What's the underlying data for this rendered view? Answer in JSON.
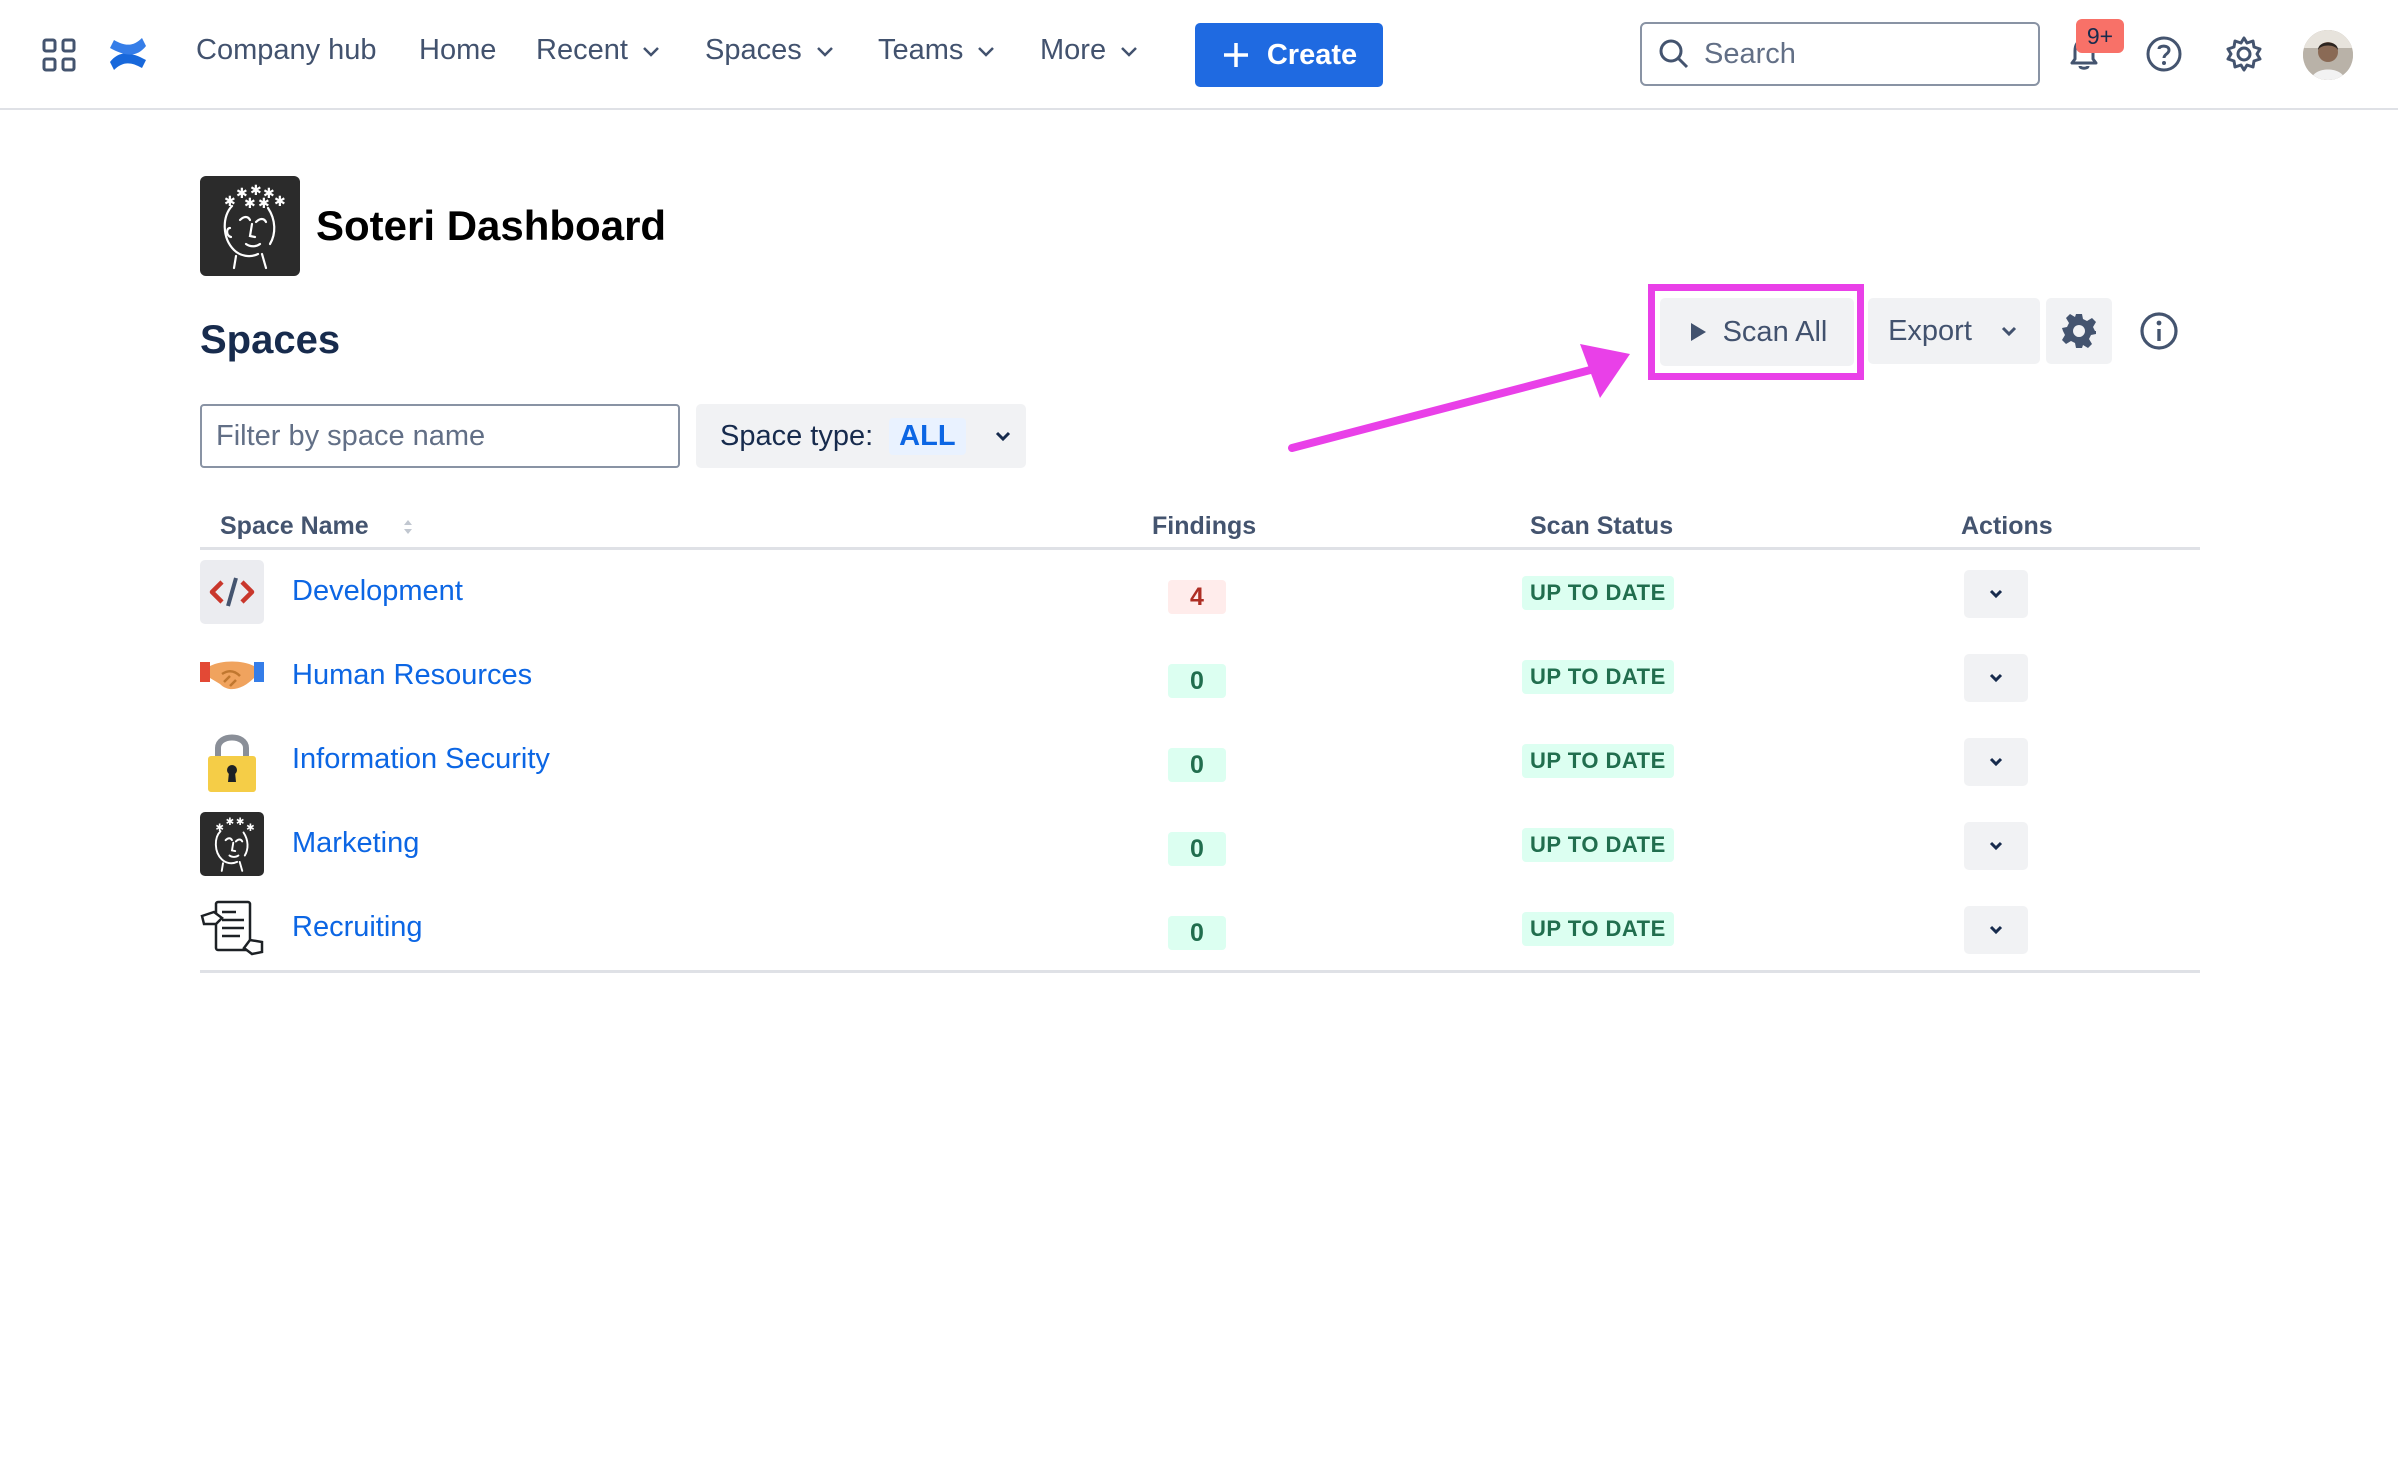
{
  "nav": {
    "company_hub": "Company hub",
    "home": "Home",
    "recent": "Recent",
    "spaces": "Spaces",
    "teams": "Teams",
    "more": "More",
    "create": "Create",
    "search_placeholder": "Search",
    "notification_count": "9+"
  },
  "page": {
    "title": "Soteri Dashboard",
    "section_title": "Spaces"
  },
  "toolbar": {
    "scan_all": "Scan All",
    "export": "Export"
  },
  "filters": {
    "space_name_placeholder": "Filter by space name",
    "space_type_label": "Space type:",
    "space_type_value": "ALL"
  },
  "table": {
    "columns": [
      "Space Name",
      "Findings",
      "Scan Status",
      "Actions"
    ],
    "rows": [
      {
        "name": "Development",
        "findings": "4",
        "status": "UP TO DATE",
        "icon": "code-icon"
      },
      {
        "name": "Human Resources",
        "findings": "0",
        "status": "UP TO DATE",
        "icon": "handshake-icon"
      },
      {
        "name": "Information Security",
        "findings": "0",
        "status": "UP TO DATE",
        "icon": "padlock-icon"
      },
      {
        "name": "Marketing",
        "findings": "0",
        "status": "UP TO DATE",
        "icon": "soteri-logo-icon"
      },
      {
        "name": "Recruiting",
        "findings": "0",
        "status": "UP TO DATE",
        "icon": "resume-icon"
      }
    ]
  },
  "colors": {
    "primary": "#1f6ae1",
    "link": "#0c66e4",
    "annotation": "#e940e8",
    "success_bg": "#dcfff1",
    "success_text": "#216e4e",
    "danger_bg": "#ffeceb",
    "danger_text": "#ae2e24"
  }
}
